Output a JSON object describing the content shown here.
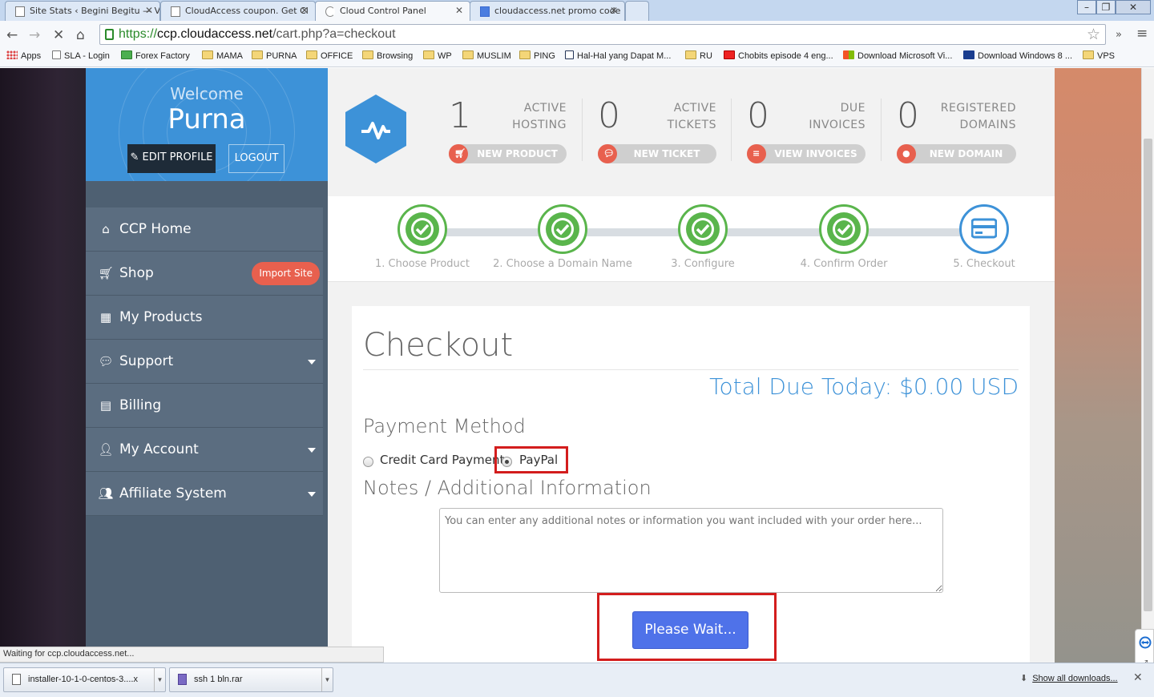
{
  "browser": {
    "tabs": [
      {
        "title": "Site Stats ‹ Begini Begitu — V",
        "active": false
      },
      {
        "title": "CloudAccess coupon. Get Cl",
        "active": false
      },
      {
        "title": "Cloud Control Panel",
        "active": true
      },
      {
        "title": "cloudaccess.net promo code",
        "active": false
      }
    ],
    "window_buttons": [
      "–",
      "❐",
      "✕"
    ],
    "url_scheme": "https://",
    "url_host": "ccp.cloudaccess.net",
    "url_path": "/cart.php?a=checkout",
    "overflow_chevron": "»",
    "bookmarks": [
      {
        "label": "Apps",
        "icon": "apps-grid-icon"
      },
      {
        "label": "SLA - Login",
        "icon": "page-icon"
      },
      {
        "label": "Forex Factory",
        "icon": "forexfactory-icon"
      },
      {
        "label": "MAMA",
        "icon": "folder-icon"
      },
      {
        "label": "PURNA",
        "icon": "folder-icon"
      },
      {
        "label": "OFFICE",
        "icon": "folder-icon"
      },
      {
        "label": "Browsing",
        "icon": "folder-icon"
      },
      {
        "label": "WP",
        "icon": "folder-icon"
      },
      {
        "label": "MUSLIM",
        "icon": "folder-icon"
      },
      {
        "label": "PING",
        "icon": "folder-icon"
      },
      {
        "label": "Hal-Hal yang Dapat M...",
        "icon": "utorrent-icon"
      },
      {
        "label": "RU",
        "icon": "folder-icon"
      },
      {
        "label": "Chobits episode 4 eng...",
        "icon": "youtube-icon"
      },
      {
        "label": "Download Microsoft Vi...",
        "icon": "microsoft-icon"
      },
      {
        "label": "Download Windows 8 ...",
        "icon": "gr-icon"
      },
      {
        "label": "VPS",
        "icon": "folder-icon"
      }
    ],
    "status_text": "Waiting for ccp.cloudaccess.net...",
    "downloads": [
      {
        "name": "installer-10-1-0-centos-3....x"
      },
      {
        "name": "ssh 1 bln.rar"
      }
    ],
    "show_all_downloads": "Show all downloads..."
  },
  "sidebar": {
    "welcome": "Welcome",
    "username": "Purna",
    "edit_profile": "EDIT PROFILE",
    "logout": "LOGOUT",
    "items": [
      {
        "label": "CCP Home",
        "icon": "home-icon"
      },
      {
        "label": "Shop",
        "icon": "cart-icon",
        "badge": "Import Site"
      },
      {
        "label": "My Products",
        "icon": "grid-icon"
      },
      {
        "label": "Support",
        "icon": "chat-icon",
        "dropdown": true
      },
      {
        "label": "Billing",
        "icon": "credit-card-icon"
      },
      {
        "label": "My Account",
        "icon": "user-icon",
        "dropdown": true
      },
      {
        "label": "Affiliate System",
        "icon": "users-icon",
        "dropdown": true
      }
    ]
  },
  "stats": [
    {
      "count": "1",
      "label_line1": "ACTIVE",
      "label_line2": "HOSTING",
      "button": "NEW PRODUCT",
      "icon": "cart-icon"
    },
    {
      "count": "0",
      "label_line1": "ACTIVE",
      "label_line2": "TICKETS",
      "button": "NEW TICKET",
      "icon": "chat-icon"
    },
    {
      "count": "0",
      "label_line1": "DUE",
      "label_line2": "INVOICES",
      "button": "VIEW INVOICES",
      "icon": "list-icon"
    },
    {
      "count": "0",
      "label_line1": "REGISTERED",
      "label_line2": "DOMAINS",
      "button": "NEW DOMAIN",
      "icon": "globe-icon"
    }
  ],
  "steps": [
    {
      "label": "1. Choose Product",
      "done": true
    },
    {
      "label": "2. Choose a Domain Name",
      "done": true
    },
    {
      "label": "3. Configure",
      "done": true
    },
    {
      "label": "4. Confirm Order",
      "done": true
    },
    {
      "label": "5. Checkout",
      "done": false
    }
  ],
  "checkout": {
    "title": "Checkout",
    "total": "Total Due Today: $0.00 USD",
    "payment_method_title": "Payment Method",
    "payment_options": [
      {
        "label": "Credit Card Payment",
        "selected": false
      },
      {
        "label": "PayPal",
        "selected": true
      }
    ],
    "notes_title": "Notes / Additional Information",
    "notes_placeholder": "You can enter any additional notes or information you want included with your order here...",
    "submit_label": "Please Wait..."
  },
  "colors": {
    "accent_blue": "#3d92d8",
    "success_green": "#5ab54c",
    "button_coral": "#e8604e",
    "sidebar": "#5b6d80",
    "highlight_red": "#d31d1d",
    "submit_blue": "#4f72e9"
  }
}
